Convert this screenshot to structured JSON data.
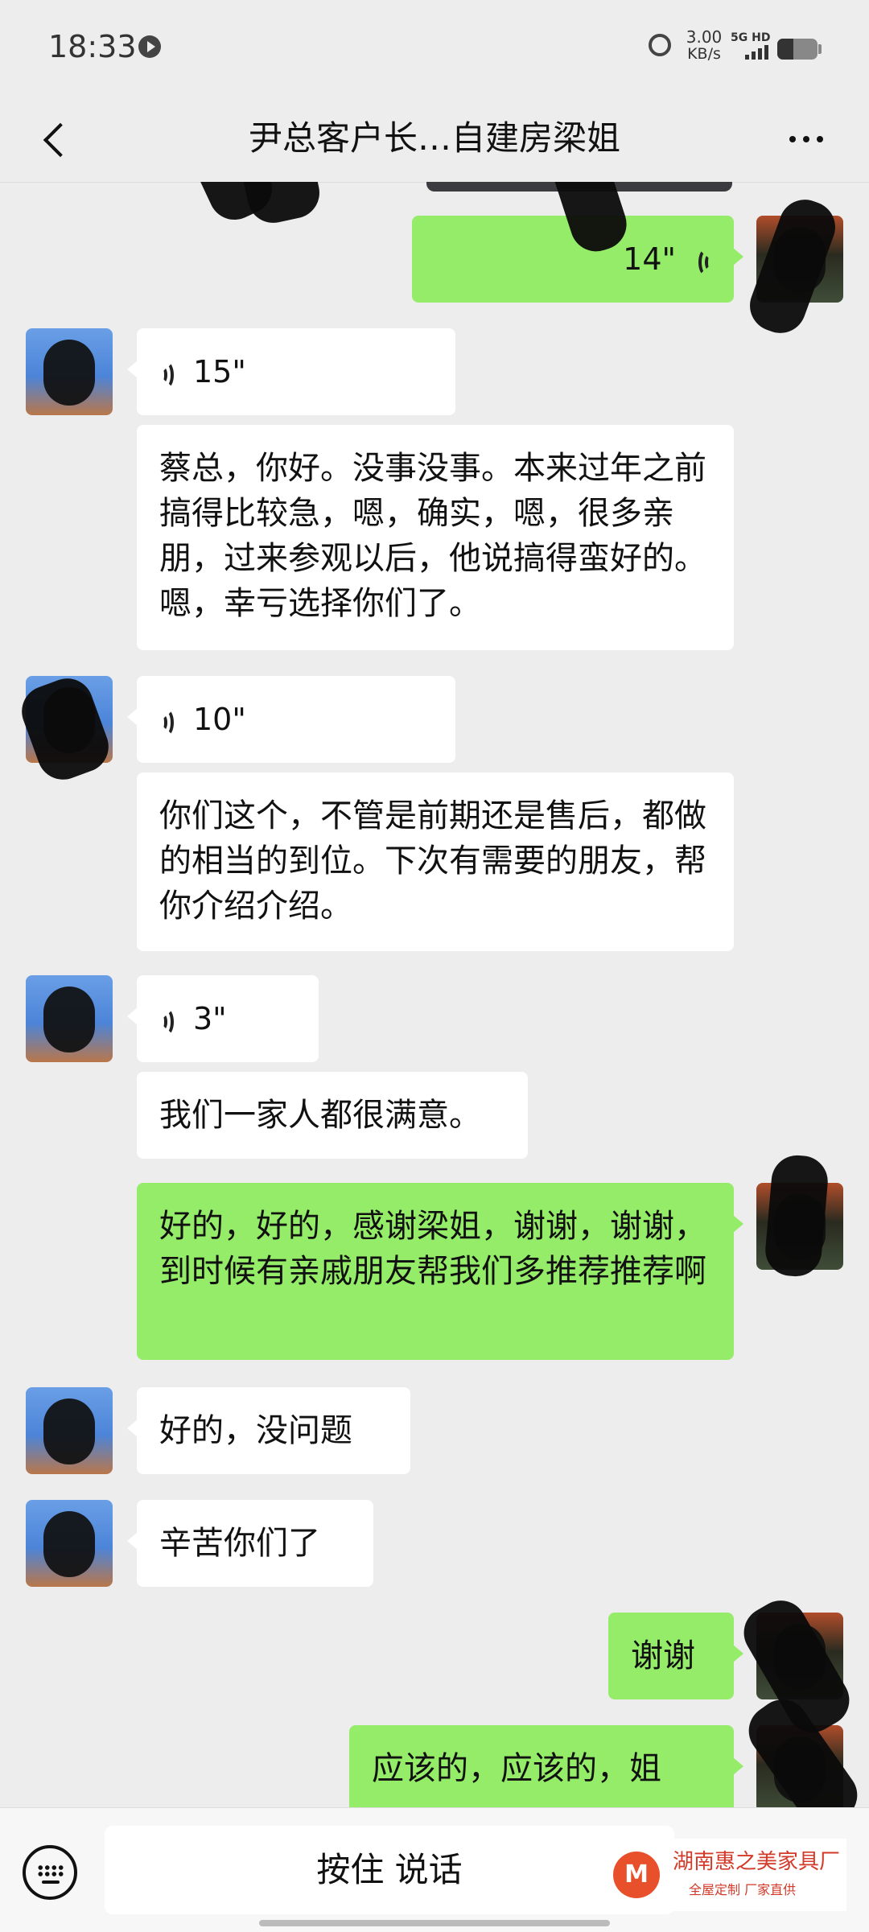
{
  "status_bar": {
    "time": "18:33",
    "net_speed_value": "3.00",
    "net_speed_unit": "KB/s",
    "signal_label": "5G HD",
    "battery_level": 0.4
  },
  "nav": {
    "title": "尹总客户长…自建房梁姐"
  },
  "messages": [
    {
      "side": "right",
      "type": "voice",
      "duration": "14\""
    },
    {
      "side": "left",
      "type": "voice",
      "duration": "15\""
    },
    {
      "side": "left",
      "type": "text",
      "text": "蔡总，你好。没事没事。本来过年之前搞得比较急，嗯，确实，嗯，很多亲朋，过来参观以后，他说搞得蛮好的。嗯，幸亏选择你们了。"
    },
    {
      "side": "left",
      "type": "voice",
      "duration": "10\""
    },
    {
      "side": "left",
      "type": "text",
      "text": "你们这个，不管是前期还是售后，都做的相当的到位。下次有需要的朋友，帮你介绍介绍。"
    },
    {
      "side": "left",
      "type": "voice",
      "duration": "3\""
    },
    {
      "side": "left",
      "type": "text",
      "text": "我们一家人都很满意。"
    },
    {
      "side": "right",
      "type": "text",
      "text": "好的，好的，感谢梁姐，谢谢，谢谢，到时候有亲戚朋友帮我们多推荐推荐啊"
    },
    {
      "side": "left",
      "type": "text",
      "text": "好的，没问题"
    },
    {
      "side": "left",
      "type": "text",
      "text": "辛苦你们了"
    },
    {
      "side": "right",
      "type": "text",
      "text": "谢谢"
    },
    {
      "side": "right",
      "type": "text",
      "text": "应该的，应该的，姐"
    }
  ],
  "input": {
    "hold_to_talk": "按住 说话"
  },
  "watermark": {
    "logo_letter": "M",
    "title": "湖南惠之美家具厂",
    "subtitle": "全屋定制 厂家直供"
  },
  "colors": {
    "background": "#ededed",
    "bubble_self": "#95ec69",
    "bubble_other": "#ffffff"
  }
}
